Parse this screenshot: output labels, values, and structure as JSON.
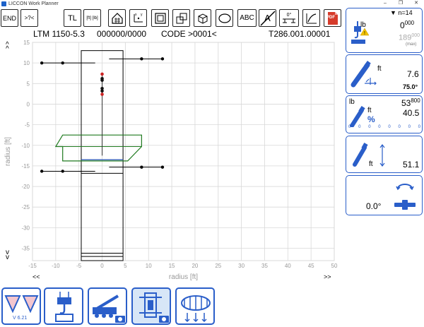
{
  "window": {
    "title": "LICCON Work Planner",
    "controls": [
      "–",
      "❐",
      "✕"
    ]
  },
  "toolbar": {
    "end_label": "END",
    "goto_label": ">?<",
    "tl_label": "TL",
    "ft_lb_label": "[ft] [lb]",
    "abc_label": "ABC",
    "a_label": "A",
    "angle_label": "0°",
    "pdf_label": "PDF"
  },
  "header": {
    "model": "LTM 1150-5.3",
    "code_numbers": "000000/0000",
    "code": "CODE >0001<",
    "table_id": "T286.001.00001"
  },
  "chart_data": {
    "type": "scatter",
    "title": "",
    "xlabel": "radius [ft]",
    "ylabel": "radius [ft]",
    "xlim": [
      -15,
      50
    ],
    "ylim": [
      -38,
      15
    ],
    "x_ticks": [
      -15,
      -10,
      -5,
      0,
      5,
      10,
      15,
      20,
      25,
      30,
      35,
      40,
      45,
      50
    ],
    "y_ticks": [
      15,
      10,
      5,
      0,
      -5,
      -10,
      -15,
      -20,
      -25,
      -30,
      -35
    ],
    "grid": true,
    "scroll_hints": {
      "up": "^",
      "down": "v",
      "left": "<<",
      "right": ">>"
    },
    "carrier_rect": {
      "x": [
        -4.5,
        4.5
      ],
      "y": [
        -38,
        13
      ]
    },
    "carrier_lines_y": [
      -16.8,
      -36.2,
      -37
    ],
    "outrigger_beams": [
      {
        "x": [
          -13,
          -1.5
        ],
        "y": 10
      },
      {
        "x": [
          1.5,
          13
        ],
        "y": 11
      },
      {
        "x": [
          -13,
          -1.5
        ],
        "y": -16.3
      },
      {
        "x": [
          1.5,
          13
        ],
        "y": -15.3
      }
    ],
    "outrigger_points": [
      {
        "x": -13,
        "y": 10
      },
      {
        "x": -8.5,
        "y": 10
      },
      {
        "x": 8.5,
        "y": 11
      },
      {
        "x": 13,
        "y": 11
      },
      {
        "x": -13,
        "y": -16.3
      },
      {
        "x": -8.5,
        "y": -16.3
      },
      {
        "x": 8.5,
        "y": -15.3
      },
      {
        "x": 13,
        "y": -15.3
      }
    ],
    "boom_line": {
      "x": 0,
      "y": [
        7.6,
        -12.5
      ]
    },
    "boom_marks": [
      {
        "x": 0,
        "y": 7.3,
        "color": "#cc2222"
      },
      {
        "x": 0,
        "y": 6.2,
        "color": "#111111"
      },
      {
        "x": 0,
        "y": 5.8,
        "color": "#111111"
      },
      {
        "x": 0,
        "y": 3.8,
        "color": "#111111"
      },
      {
        "x": 0,
        "y": 3.2,
        "color": "#111111"
      },
      {
        "x": 0,
        "y": 2.4,
        "color": "#cc2222"
      }
    ],
    "counterweight_polygon": [
      [
        -8.5,
        -7.5
      ],
      [
        8.5,
        -7.5
      ],
      [
        8.5,
        -10.3
      ],
      [
        5.5,
        -13.8
      ],
      [
        -8.5,
        -13.8
      ],
      [
        -8.5,
        -10.3
      ],
      [
        -10,
        -10.3
      ]
    ],
    "counterweight_line_y": -10.3,
    "counterweight_color": "#1f7a1f",
    "turntable_line": {
      "x": [
        -4.5,
        4.5
      ],
      "y": -13.5,
      "color": "#1f4fb0"
    }
  },
  "right_panel": {
    "count": "▼ n=14",
    "load_unit": "lb",
    "load_value": "0",
    "load_value_sup": "000",
    "load_max": "189",
    "load_max_sup": "000",
    "load_max_label": "(max)",
    "radius_unit": "ft",
    "radius_value": "7.6",
    "boom_angle": "75.0°",
    "util_load_unit": "lb",
    "util_load": "53",
    "util_load_sup": "800",
    "util_radius_unit": "ft",
    "util_radius": "40.5",
    "util_percent_symbol": "%",
    "util_scale": [
      "0",
      "0",
      "0",
      "0",
      "0",
      "0",
      "0",
      "0"
    ],
    "height_unit": "ft",
    "height_value": "51.1",
    "slew_angle": "0.0°"
  },
  "bottom": {
    "version": "V 6.21"
  },
  "colors": {
    "accent": "#2a5ec9",
    "grid": "#d8d8d8",
    "counterweight": "#1f7a1f",
    "warning": "#f2c200",
    "pdf": "#d63b2b"
  }
}
